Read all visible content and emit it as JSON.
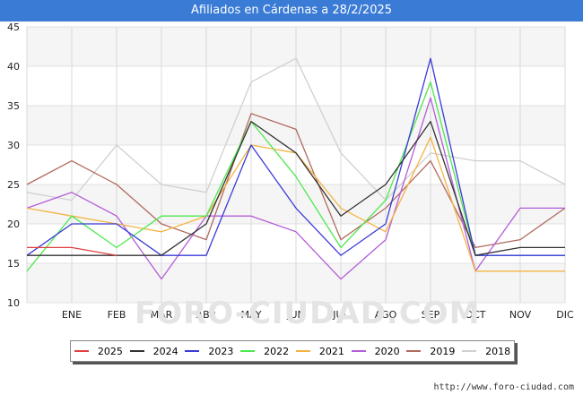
{
  "title": "Afiliados en Cárdenas a 28/2/2025",
  "watermark": "FORO-CIUDAD.COM",
  "source": "http://www.foro-ciudad.com",
  "chart_data": {
    "type": "line",
    "title": "Afiliados en Cárdenas a 28/2/2025",
    "xlabel": "",
    "ylabel": "",
    "categories": [
      "",
      "ENE",
      "FEB",
      "MAR",
      "ABR",
      "MAY",
      "JUN",
      "JUL",
      "AGO",
      "SEP",
      "OCT",
      "NOV",
      "DIC"
    ],
    "ylim": [
      10,
      45
    ],
    "yticks": [
      10,
      15,
      20,
      25,
      30,
      35,
      40,
      45
    ],
    "grid": true,
    "legend_position": "bottom",
    "series": [
      {
        "name": "2018",
        "color": "#d0d0d0",
        "values": [
          24,
          23,
          30,
          25,
          24,
          38,
          41,
          29,
          23,
          29,
          28,
          28,
          25
        ]
      },
      {
        "name": "2019",
        "color": "#b06a5e",
        "values": [
          25,
          28,
          25,
          20,
          18,
          34,
          32,
          18,
          22,
          28,
          17,
          18,
          22
        ]
      },
      {
        "name": "2020",
        "color": "#b35ed8",
        "values": [
          22,
          24,
          21,
          13,
          21,
          21,
          19,
          13,
          18,
          36,
          14,
          22,
          22
        ]
      },
      {
        "name": "2021",
        "color": "#f4b445",
        "values": [
          22,
          21,
          20,
          19,
          21,
          30,
          29,
          22,
          19,
          31,
          14,
          14,
          14
        ]
      },
      {
        "name": "2022",
        "color": "#4de84d",
        "values": [
          14,
          21,
          17,
          21,
          21,
          33,
          26,
          17,
          23,
          38,
          16,
          16,
          16
        ]
      },
      {
        "name": "2023",
        "color": "#3b3bd8",
        "values": [
          16,
          20,
          20,
          16,
          16,
          30,
          22,
          16,
          20,
          41,
          16,
          16,
          16
        ]
      },
      {
        "name": "2024",
        "color": "#333333",
        "values": [
          16,
          16,
          16,
          16,
          20,
          33,
          29,
          21,
          25,
          33,
          16,
          17,
          17
        ]
      },
      {
        "name": "2025",
        "color": "#e04040",
        "values": [
          17,
          17,
          16,
          null,
          null,
          null,
          null,
          null,
          null,
          null,
          null,
          null,
          null
        ]
      }
    ],
    "legend_order": [
      "2025",
      "2024",
      "2023",
      "2022",
      "2021",
      "2020",
      "2019",
      "2018"
    ]
  }
}
